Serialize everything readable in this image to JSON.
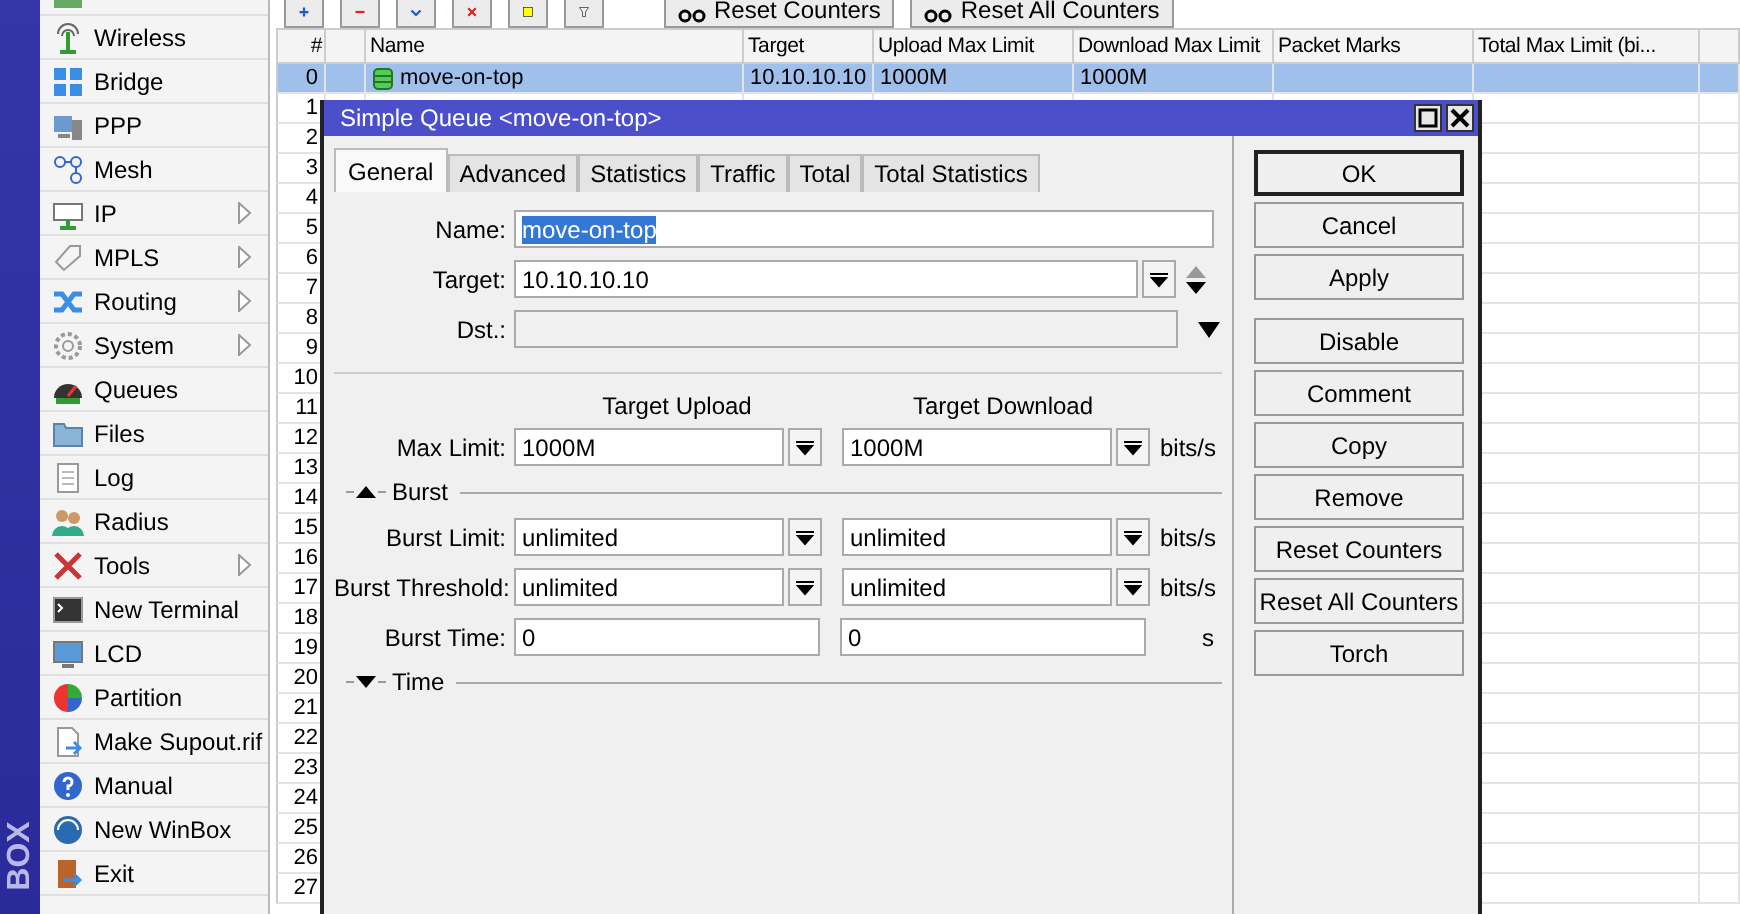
{
  "side_strip": {
    "text": "BOX"
  },
  "menu": [
    {
      "submenu": false
    },
    {
      "label": "Wireless",
      "submenu": false
    },
    {
      "label": "Bridge",
      "submenu": false
    },
    {
      "label": "PPP",
      "submenu": false
    },
    {
      "label": "Mesh",
      "submenu": false
    },
    {
      "label": "IP",
      "submenu": true
    },
    {
      "label": "MPLS",
      "submenu": true
    },
    {
      "label": "Routing",
      "submenu": true
    },
    {
      "label": "System",
      "submenu": true
    },
    {
      "label": "Queues",
      "submenu": false
    },
    {
      "label": "Files",
      "submenu": false
    },
    {
      "label": "Log",
      "submenu": false
    },
    {
      "label": "Radius",
      "submenu": false
    },
    {
      "label": "Tools",
      "submenu": true
    },
    {
      "label": "New Terminal",
      "submenu": false
    },
    {
      "label": "LCD",
      "submenu": false
    },
    {
      "label": "Partition",
      "submenu": false
    },
    {
      "label": "Make Supout.rif",
      "submenu": false
    },
    {
      "label": "Manual",
      "submenu": false
    },
    {
      "label": "New WinBox",
      "submenu": false
    },
    {
      "label": "Exit",
      "submenu": false
    }
  ],
  "toolbar": {
    "buttons": [
      {
        "label": "Reset Counters"
      },
      {
        "label": "Reset All Counters"
      }
    ]
  },
  "table": {
    "columns": [
      "#",
      "Name",
      "Target",
      "Upload Max Limit",
      "Download Max Limit",
      "Packet Marks",
      "Total Max Limit (bi..."
    ],
    "rows": [
      {
        "number": "0",
        "name": "move-on-top",
        "target": "10.10.10.10",
        "upload_max_limit": "1000M",
        "download_max_limit": "1000M",
        "selected": true
      },
      {
        "number": "1",
        "selected": false
      },
      {
        "number": "2",
        "selected": false
      },
      {
        "number": "3",
        "selected": false
      },
      {
        "number": "4",
        "selected": false
      },
      {
        "number": "5",
        "selected": false
      },
      {
        "number": "6",
        "selected": false
      },
      {
        "number": "7",
        "selected": false
      },
      {
        "number": "8",
        "selected": false
      },
      {
        "number": "9",
        "selected": false
      },
      {
        "number": "10",
        "selected": false
      },
      {
        "number": "11",
        "selected": false
      },
      {
        "number": "12",
        "selected": false
      },
      {
        "number": "13",
        "selected": false
      },
      {
        "number": "14",
        "selected": false
      },
      {
        "number": "15",
        "selected": false
      },
      {
        "number": "16",
        "selected": false
      },
      {
        "number": "17",
        "selected": false
      },
      {
        "number": "18",
        "selected": false
      },
      {
        "number": "19",
        "selected": false
      },
      {
        "number": "20",
        "selected": false
      },
      {
        "number": "21",
        "selected": false
      },
      {
        "number": "22",
        "selected": false
      },
      {
        "number": "23",
        "selected": false
      },
      {
        "number": "24",
        "selected": false
      },
      {
        "number": "25",
        "selected": false
      },
      {
        "number": "26",
        "selected": false
      },
      {
        "number": "27",
        "selected": false
      }
    ]
  },
  "dialog": {
    "title": "Simple Queue <move-on-top>",
    "tabs": [
      {
        "label": "General",
        "selected": true
      },
      {
        "label": "Advanced",
        "selected": false
      },
      {
        "label": "Statistics",
        "selected": false
      },
      {
        "label": "Traffic",
        "selected": false
      },
      {
        "label": "Total",
        "selected": false
      },
      {
        "label": "Total Statistics",
        "selected": false
      }
    ],
    "name": {
      "label": "Name:",
      "value": "move-on-top",
      "highlighted": true
    },
    "target": {
      "label": "Target:",
      "value": "10.10.10.10"
    },
    "dst": {
      "label": "Dst.:",
      "disabled": true
    },
    "column_headers": [
      "Target Upload",
      "Target Download"
    ],
    "limits": [
      {
        "label": "Max Limit:",
        "kind": "dropdown",
        "upload": "1000M",
        "download": "1000M",
        "unit": "bits/s"
      }
    ],
    "sections": [
      {
        "title": "Burst",
        "expanded": true,
        "rows": [
          {
            "label": "Burst Limit:",
            "kind": "dropdown",
            "upload": "unlimited",
            "download": "unlimited",
            "unit": "bits/s"
          },
          {
            "label": "Burst Threshold:",
            "kind": "dropdown",
            "upload": "unlimited",
            "download": "unlimited",
            "unit": "bits/s"
          },
          {
            "label": "Burst Time:",
            "kind": "plain",
            "upload": "0",
            "download": "0",
            "unit": "s"
          }
        ]
      },
      {
        "title": "Time",
        "expanded": false
      }
    ],
    "button_groups": [
      [
        {
          "label": "OK",
          "default": true
        },
        {
          "label": "Cancel",
          "default": false
        },
        {
          "label": "Apply",
          "default": false
        }
      ],
      [
        {
          "label": "Disable",
          "default": false
        },
        {
          "label": "Comment",
          "default": false
        },
        {
          "label": "Copy",
          "default": false
        },
        {
          "label": "Remove",
          "default": false
        },
        {
          "label": "Reset Counters",
          "default": false
        },
        {
          "label": "Reset All Counters",
          "default": false
        },
        {
          "label": "Torch",
          "default": false
        }
      ]
    ]
  }
}
